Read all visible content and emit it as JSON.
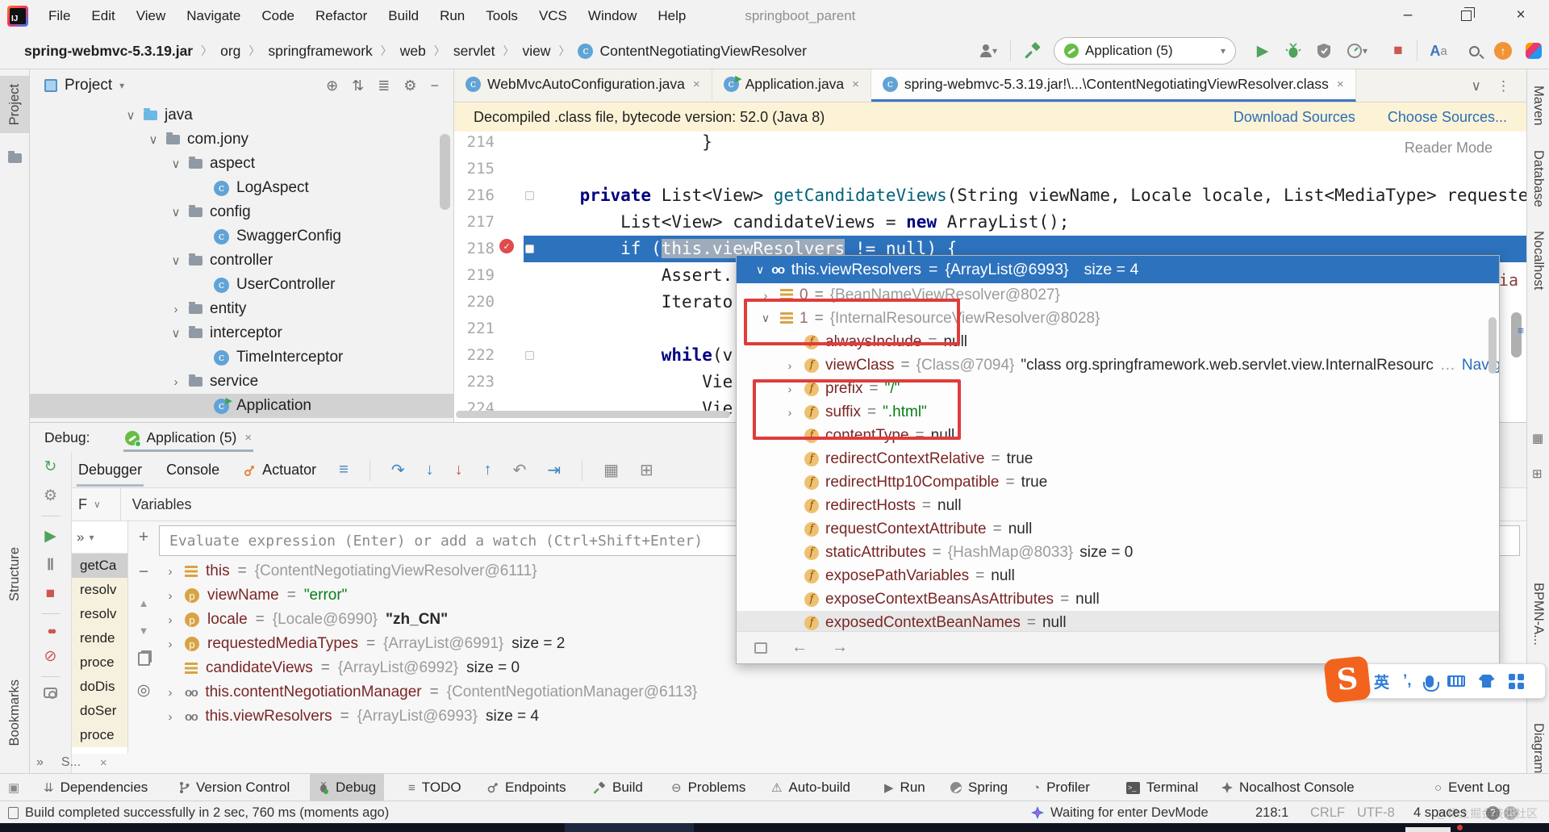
{
  "colors": {
    "selection_blue": "#2d72bd",
    "breakpoint_red": "#e04b4b",
    "annotation_red": "#e03c3c",
    "string_green": "#067d17",
    "keyword_blue": "#000080",
    "method_teal": "#00627a",
    "link_blue": "#2a6db5",
    "field_maroon": "#7a2626",
    "spring_green": "#68bd45",
    "banner_yellow": "#fcf3d7"
  },
  "ui": {
    "eq": " = ",
    "chev_open": "∨",
    "chev_closed": "›",
    "close_x": "×",
    "minimize": "–",
    "overflow": "»",
    "more_dots": "⋮",
    "dropdown": "∨",
    "plus": "+",
    "minus": "−",
    "up": "▲",
    "down": "▼",
    "watch_cfg": "◎",
    "back": "←",
    "forward": "→"
  },
  "titlebar": {
    "menus": [
      "File",
      "Edit",
      "View",
      "Navigate",
      "Code",
      "Refactor",
      "Build",
      "Run",
      "Tools",
      "VCS",
      "Window",
      "Help"
    ],
    "title": "springboot_parent"
  },
  "breadcrumb": [
    "spring-webmvc-5.3.19.jar",
    "org",
    "springframework",
    "web",
    "servlet",
    "view",
    "ContentNegotiatingViewResolver"
  ],
  "run_widget": {
    "config": "Application (5)"
  },
  "editor_tabs": [
    {
      "label": "WebMvcAutoConfiguration.java"
    },
    {
      "label": "Application.java"
    },
    {
      "label": "spring-webmvc-5.3.19.jar!\\...\\ContentNegotiatingViewResolver.class"
    }
  ],
  "banner": {
    "message": "Decompiled .class file, bytecode version: 52.0 (Java 8)",
    "download": "Download Sources",
    "choose": "Choose Sources..."
  },
  "reader_mode": "Reader Mode",
  "project": {
    "title": "Project",
    "items": [
      {
        "label": "java"
      },
      {
        "label": "com.jony"
      },
      {
        "label": "aspect"
      },
      {
        "label": "LogAspect"
      },
      {
        "label": "config"
      },
      {
        "label": "SwaggerConfig"
      },
      {
        "label": "controller"
      },
      {
        "label": "UserController"
      },
      {
        "label": "entity"
      },
      {
        "label": "interceptor"
      },
      {
        "label": "TimeInterceptor"
      },
      {
        "label": "service"
      },
      {
        "label": "Application"
      }
    ]
  },
  "editor": {
    "fragment": "ia",
    "lines": [
      {
        "num": "214",
        "t1": "                }"
      },
      {
        "num": "215",
        "t1": ""
      },
      {
        "num": "216",
        "k1": "    private ",
        "t1": "List<View> ",
        "m": "getCandidateViews",
        "t2": "(String viewName, Locale locale, List<MediaType> requestedMedia"
      },
      {
        "num": "217",
        "t1": "        List<View> candidateViews = ",
        "k1": "new",
        "t2": " ArrayList();"
      },
      {
        "num": "218",
        "t1": "        if (",
        "hl": "this.viewResolvers",
        "t2": " != null) {"
      },
      {
        "num": "219",
        "t1": "            Assert."
      },
      {
        "num": "220",
        "t1": "            Iterato"
      },
      {
        "num": "221",
        "t1": ""
      },
      {
        "num": "222",
        "k1": "            while",
        "t1": "(v"
      },
      {
        "num": "223",
        "t1": "                Vie"
      },
      {
        "num": "224",
        "t1": "                Vie"
      }
    ]
  },
  "popup": {
    "header": {
      "name": "this.viewResolvers",
      "ref": "{ArrayList@6993}",
      "size": "size = 4"
    },
    "rows": [
      {
        "name": "0",
        "ref": "{BeanNameViewResolver@8027}"
      },
      {
        "name": "1",
        "ref": "{InternalResourceViewResolver@8028}"
      },
      {
        "name": "alwaysInclude",
        "val": "null"
      },
      {
        "name": "viewClass",
        "ref": "{Class@7094}",
        "strb": "\"class org.springframework.web.servlet.view.InternalResourc",
        "ell": "…",
        "link": "Navigate"
      },
      {
        "name": "prefix",
        "strg": "\"/\""
      },
      {
        "name": "suffix",
        "strg": "\".html\""
      },
      {
        "name": "contentType",
        "val": "null"
      },
      {
        "name": "redirectContextRelative",
        "val": "true"
      },
      {
        "name": "redirectHttp10Compatible",
        "val": "true"
      },
      {
        "name": "redirectHosts",
        "val": "null"
      },
      {
        "name": "requestContextAttribute",
        "val": "null"
      },
      {
        "name": "staticAttributes",
        "ref": "{HashMap@8033}",
        "size": "size = 0"
      },
      {
        "name": "exposePathVariables",
        "val": "null"
      },
      {
        "name": "exposeContextBeansAsAttributes",
        "val": "null"
      },
      {
        "name": "exposedContextBeanNames",
        "val": "null"
      }
    ]
  },
  "debug": {
    "label": "Debug:",
    "session": "Application (5)",
    "tab_debugger": "Debugger",
    "tab_console": "Console",
    "tab_actuator": "Actuator",
    "frames_label": "F",
    "variables_label": "Variables",
    "evaluate": "Evaluate expression (Enter) or add a watch (Ctrl+Shift+Enter)",
    "frames": [
      "getCa",
      "resolv",
      "resolv",
      "rende",
      "proce",
      "doDis",
      "doSer",
      "proce"
    ],
    "collapsed": "S...",
    "vars": [
      {
        "name": "this",
        "ref": "{ContentNegotiatingViewResolver@6111}"
      },
      {
        "name": "viewName",
        "strg": "\"error\""
      },
      {
        "name": "locale",
        "ref": "{Locale@6990}",
        "strb": "\"zh_CN\""
      },
      {
        "name": "requestedMediaTypes",
        "ref": "{ArrayList@6991}",
        "size": "size = 2"
      },
      {
        "name": "candidateViews",
        "ref": "{ArrayList@6992}",
        "size": "size = 0"
      },
      {
        "name": "this.contentNegotiationManager",
        "ref": "{ContentNegotiationManager@6113}"
      },
      {
        "name": "this.viewResolvers",
        "ref": "{ArrayList@6993}",
        "size": "size = 4"
      }
    ]
  },
  "tool_buttons": [
    "Dependencies",
    "Version Control",
    "Debug",
    "TODO",
    "Endpoints",
    "Build",
    "Problems",
    "Auto-build",
    "Run",
    "Spring",
    "Profiler",
    "Terminal",
    "Nocalhost Console",
    "Event Log"
  ],
  "status": {
    "build": "Build completed successfully in 2 sec, 760 ms (moments ago)",
    "devmode": "Waiting for enter DevMode",
    "position": "218:1",
    "line_sep": "CRLF",
    "encoding": "UTF-8",
    "indent": "4 spaces",
    "watermark": "@稀土掘金技术社区"
  },
  "left_strip": [
    "Project",
    "Structure",
    "Bookmarks"
  ],
  "right_strip": [
    "Maven",
    "Database",
    "Nocalhost",
    "BPMN-A...",
    "Diagram"
  ],
  "ime": {
    "lang": "英",
    "punct": "’,",
    "logo": "S"
  }
}
